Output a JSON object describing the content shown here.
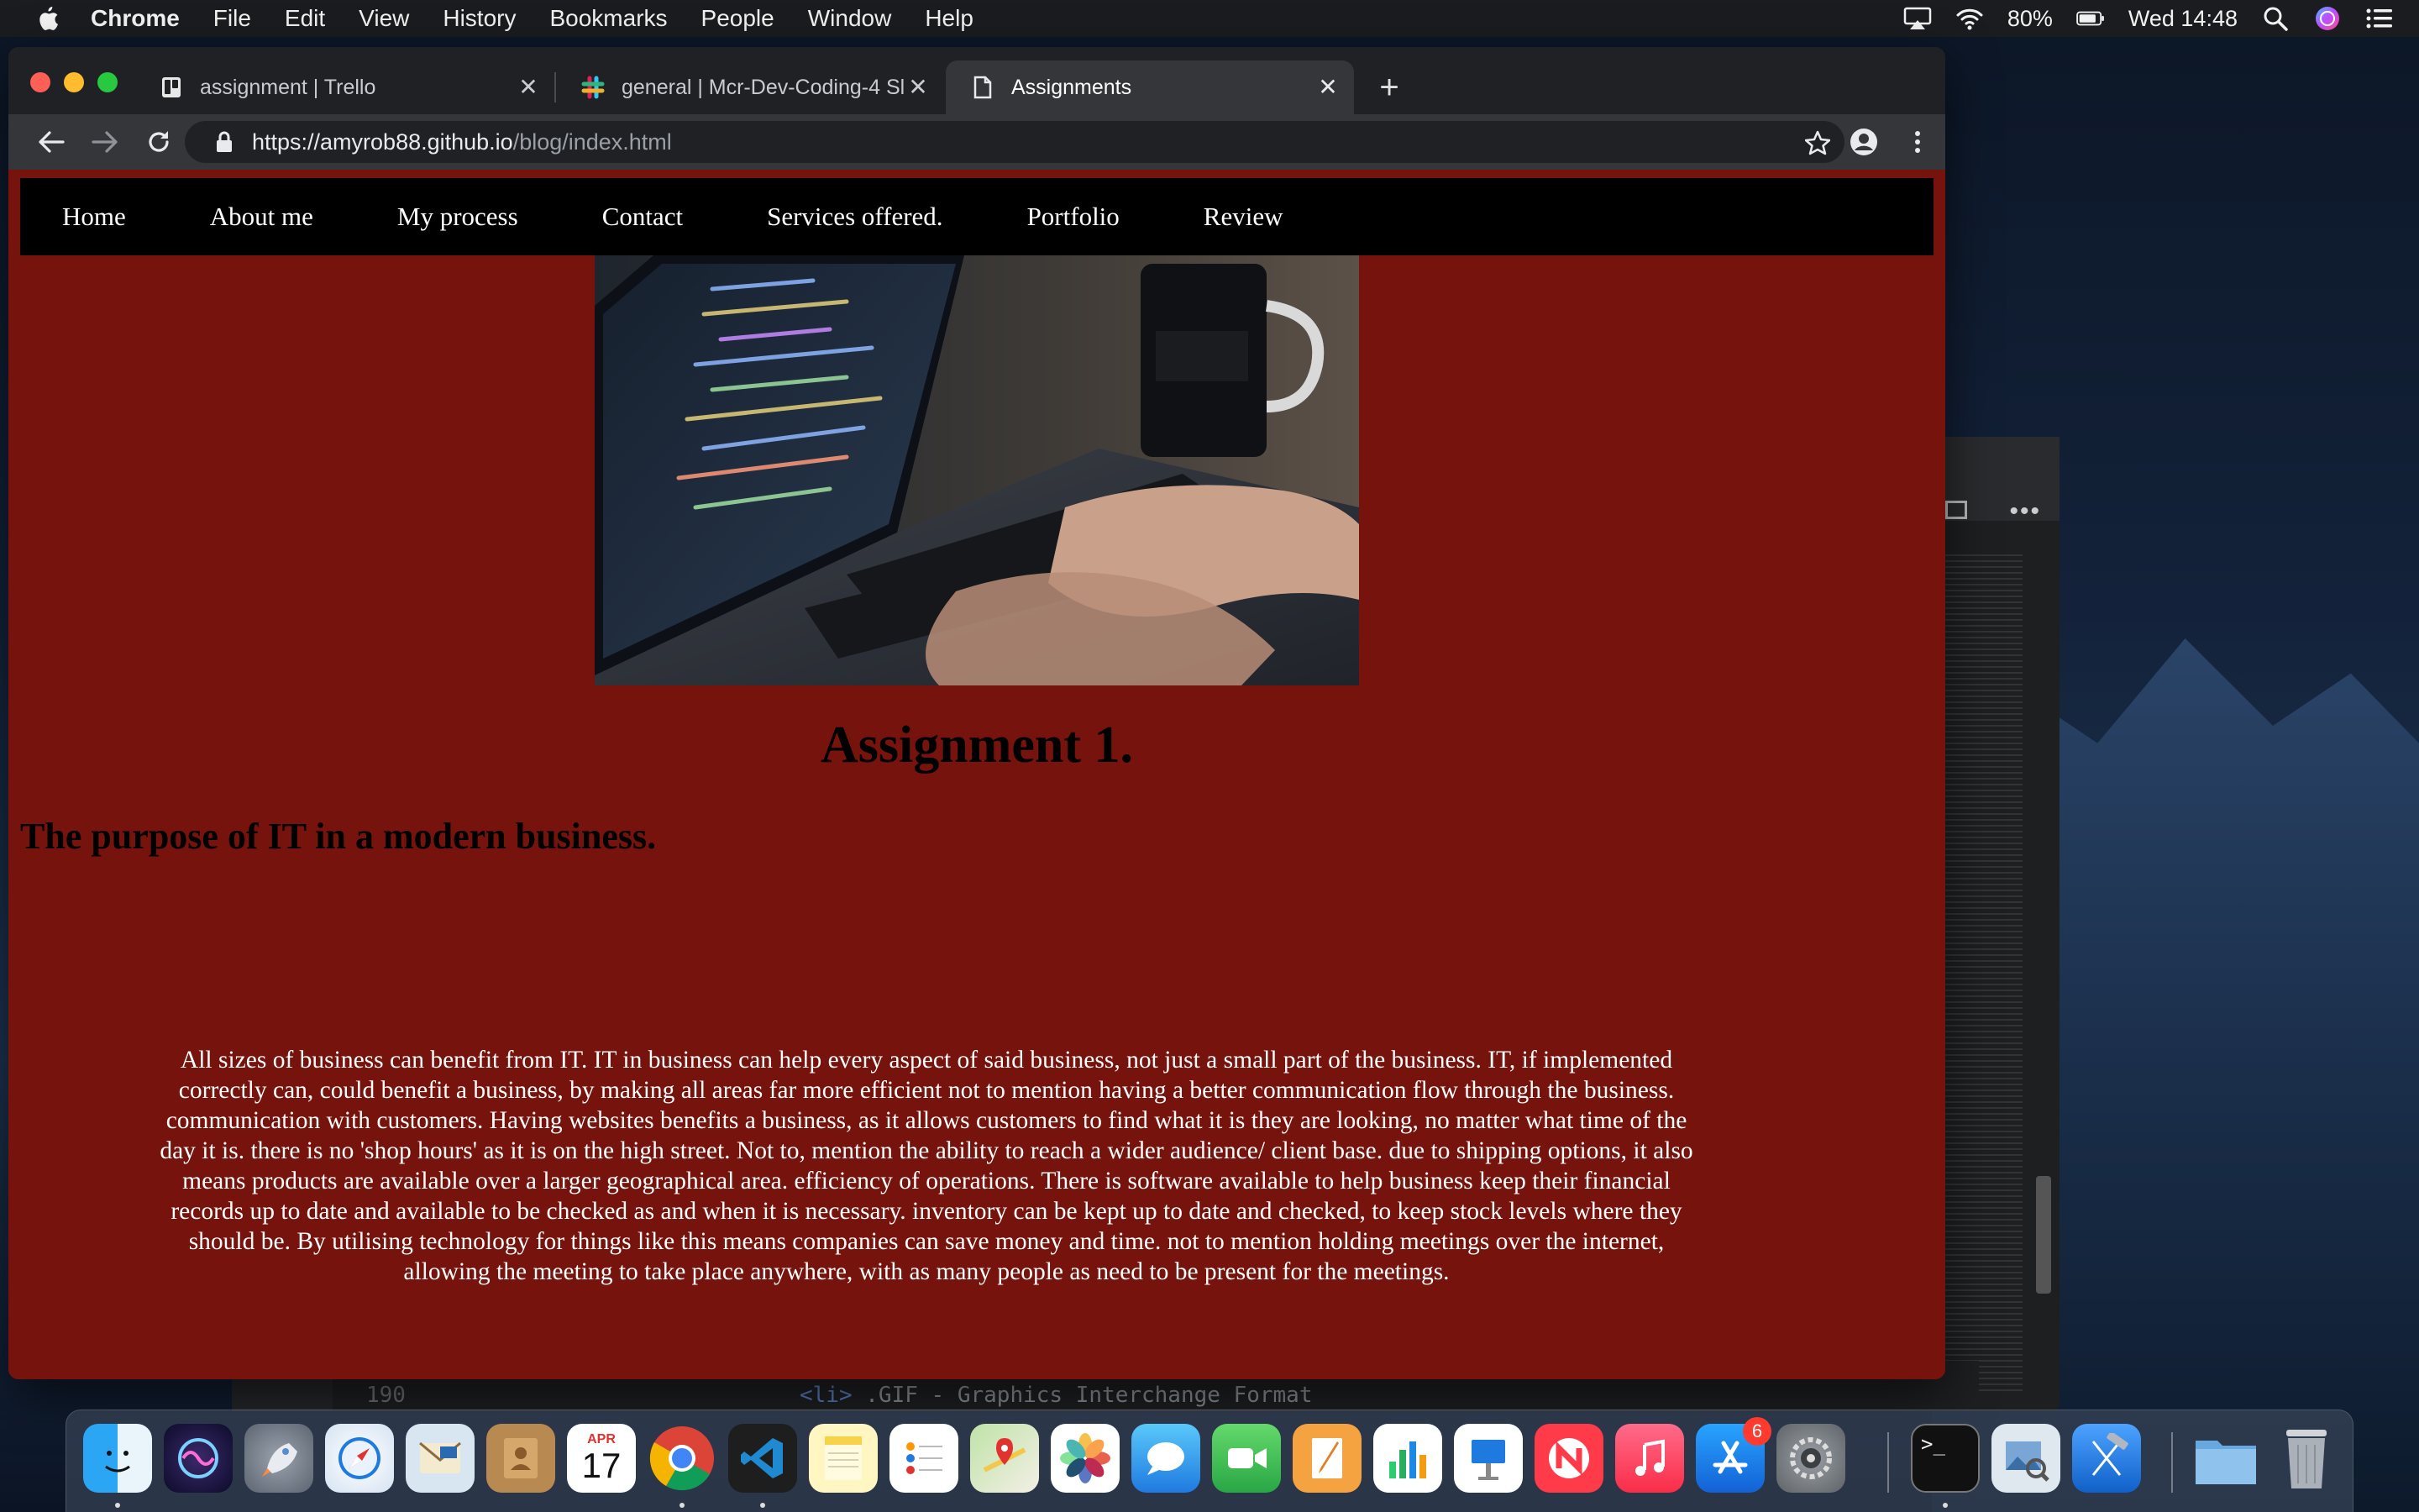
{
  "menubar": {
    "app_name": "Chrome",
    "items": [
      "File",
      "Edit",
      "View",
      "History",
      "Bookmarks",
      "People",
      "Window",
      "Help"
    ],
    "battery": "80%",
    "clock": "Wed 14:48"
  },
  "browser": {
    "tabs": [
      {
        "title": "assignment | Trello",
        "icon": "trello-icon",
        "active": false
      },
      {
        "title": "general | Mcr-Dev-Coding-4 Sl",
        "icon": "slack-icon",
        "active": false
      },
      {
        "title": "Assignments",
        "icon": "document-icon",
        "active": true
      }
    ],
    "url_host": "https://amyrob88.github.io",
    "url_path": "/blog/index.html"
  },
  "page": {
    "nav": [
      "Home",
      "About me",
      "My process",
      "Contact",
      "Services offered.",
      "Portfolio",
      "Review"
    ],
    "title": "Assignment 1.",
    "subtitle": "The purpose of IT in a modern business.",
    "body": "All sizes of business can benefit from IT. IT in business can help every aspect of said business, not just a small part of the business. IT, if implemented correctly can, could benefit a business, by making all areas far more efficient not to mention having a better communication flow through the business. communication with customers. Having websites benefits a business, as it allows customers to find what it is they are looking, no matter what time of the day it is. there is no 'shop hours' as it is on the high street. Not to, mention the ability to reach a wider audience/ client base. due to shipping options, it also means products are available over a larger geographical area. efficiency of operations. There is software available to help business keep their financial records up to date and available to be checked as and when it is necessary. inventory can be kept up to date and checked, to keep stock levels where they should be. By utilising technology for things like this means companies can save money and time. not to mention holding meetings over the internet, allowing the meeting to take place anywhere, with as many people as need to be present for the meetings.",
    "background_color": "#76130c",
    "nav_color": "#000000"
  },
  "background_editor": {
    "line_number": "190",
    "code_tag": "<li>",
    "code_text": " .GIF - Graphics Interchange Format"
  },
  "dock": {
    "items": [
      "finder-icon",
      "siri-icon",
      "launchpad-icon",
      "safari-icon",
      "mail-icon",
      "contacts-icon",
      "calendar-icon",
      "chrome-icon",
      "vscode-icon",
      "notes-icon",
      "reminders-icon",
      "maps-icon",
      "photos-icon",
      "messages-icon",
      "facetime-icon",
      "pages-icon",
      "numbers-icon",
      "keynote-icon",
      "news-icon",
      "music-icon",
      "app-store-icon",
      "system-preferences-icon",
      "terminal-icon",
      "preview-icon",
      "xcode-icon",
      "downloads-folder-icon",
      "trash-icon"
    ],
    "calendar_month": "APR",
    "calendar_day": "17",
    "app_store_badge": "6"
  }
}
